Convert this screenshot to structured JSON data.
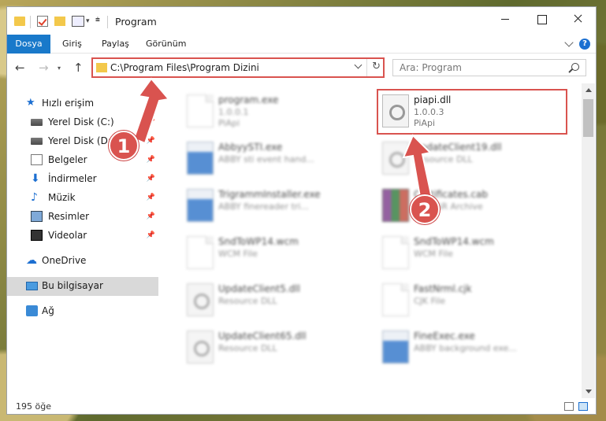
{
  "window": {
    "title": "Program"
  },
  "ribbon": {
    "tabs": [
      "Dosya",
      "Giriş",
      "Paylaş",
      "Görünüm"
    ],
    "help": "?"
  },
  "address": {
    "path": "C:\\Program Files\\Program Dizini"
  },
  "search": {
    "placeholder": "Ara: Program"
  },
  "sidebar": {
    "items": [
      {
        "label": "Hızlı erişim",
        "icon": "star-icon"
      },
      {
        "label": "Yerel Disk (C:)",
        "icon": "drive-icon",
        "pinned": true
      },
      {
        "label": "Yerel Disk (D:)",
        "icon": "drive-icon",
        "pinned": true
      },
      {
        "label": "Belgeler",
        "icon": "documents-icon",
        "pinned": true
      },
      {
        "label": "İndirmeler",
        "icon": "downloads-icon",
        "pinned": true
      },
      {
        "label": "Müzik",
        "icon": "music-icon",
        "pinned": true
      },
      {
        "label": "Resimler",
        "icon": "pictures-icon",
        "pinned": true
      },
      {
        "label": "Videolar",
        "icon": "videos-icon",
        "pinned": true
      },
      {
        "label": "OneDrive",
        "icon": "cloud-icon"
      },
      {
        "label": "Bu bilgisayar",
        "icon": "computer-icon",
        "selected": true
      },
      {
        "label": "Ağ",
        "icon": "network-icon"
      }
    ]
  },
  "files": [
    {
      "name": "program.exe",
      "line1": "1.0.0.1",
      "line2": "PiApi",
      "icon": "program-icon",
      "blurred": true
    },
    {
      "name": "piapi.dll",
      "line1": "1.0.0.3",
      "line2": "PiApi",
      "icon": "dll-gear-icon",
      "blurred": false,
      "highlighted": true
    },
    {
      "name": "AbbyySTI.exe",
      "line1": "ABBY sti event hand...",
      "line2": "",
      "icon": "exe-icon",
      "blurred": true
    },
    {
      "name": "UpdateClient19.dll",
      "line1": "Resource DLL",
      "line2": "",
      "icon": "dll-gear-icon",
      "blurred": true
    },
    {
      "name": "TrigrammInstaller.exe",
      "line1": "ABBY finereader tri...",
      "line2": "",
      "icon": "exe-icon",
      "blurred": true
    },
    {
      "name": "Certificates.cab",
      "line1": "WinRAR Archive",
      "line2": "",
      "icon": "archive-icon",
      "blurred": true
    },
    {
      "name": "SndToWP14.wcm",
      "line1": "WCM File",
      "line2": "",
      "icon": "blank-page-icon",
      "blurred": true
    },
    {
      "name": "SndToWP14.wcm",
      "line1": "WCM File",
      "line2": "",
      "icon": "blank-page-icon",
      "blurred": true
    },
    {
      "name": "UpdateClient5.dll",
      "line1": "Resource DLL",
      "line2": "",
      "icon": "dll-gear-icon",
      "blurred": true
    },
    {
      "name": "FastNrml.cjk",
      "line1": "CJK File",
      "line2": "",
      "icon": "blank-page-icon",
      "blurred": true
    },
    {
      "name": "UpdateClient65.dll",
      "line1": "Resource DLL",
      "line2": "",
      "icon": "dll-gear-icon",
      "blurred": true
    },
    {
      "name": "FineExec.exe",
      "line1": "ABBY background exe...",
      "line2": "",
      "icon": "exe-icon",
      "blurred": true
    }
  ],
  "callouts": [
    "1",
    "2"
  ],
  "status": {
    "count": "195 öğe"
  },
  "colors": {
    "accent": "#1979ca",
    "highlight": "#d9534f"
  }
}
